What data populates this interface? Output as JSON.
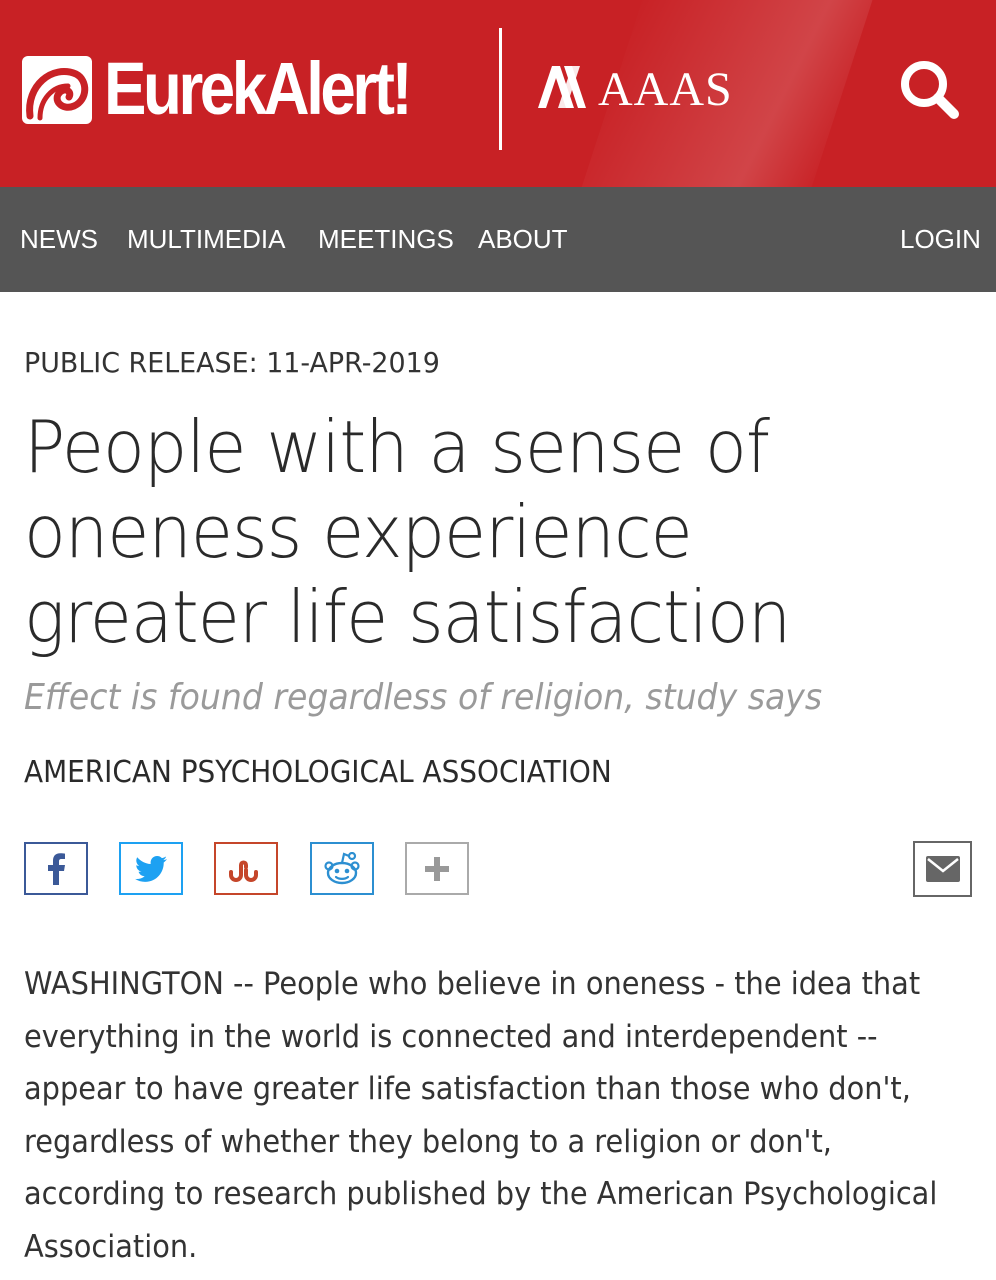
{
  "header": {
    "logo_text": "EurekAlert!",
    "partner_text": "AAAS",
    "background_color": "#c82125",
    "search_icon": "search-icon"
  },
  "nav": {
    "items": [
      {
        "label": "NEWS"
      },
      {
        "label": "MULTIMEDIA"
      },
      {
        "label": "MEETINGS"
      },
      {
        "label": "ABOUT"
      }
    ],
    "login_label": "LOGIN",
    "background_color": "#555555"
  },
  "article": {
    "release_label": "PUBLIC RELEASE: 11-APR-2019",
    "headline_lines": [
      "People with a sense of",
      "oneness experience",
      "greater life satisfaction"
    ],
    "subhead": "Effect is found regardless of religion, study says",
    "organization": "AMERICAN PSYCHOLOGICAL ASSOCIATION",
    "body_lines": [
      "WASHINGTON -- People who believe in oneness - the idea that",
      "everything in the world is connected and interdependent --",
      "appear to have greater life satisfaction than those who don't,",
      "regardless of whether they belong to a religion or don't,",
      "according to research published by the American Psychological",
      "Association."
    ]
  },
  "share": {
    "buttons": [
      {
        "icon": "facebook-icon",
        "color": "#3b5998"
      },
      {
        "icon": "twitter-icon",
        "color": "#1da1f2"
      },
      {
        "icon": "stumbleupon-icon",
        "color": "#c5462a"
      },
      {
        "icon": "reddit-icon",
        "color": "#2c8fd1"
      },
      {
        "icon": "plus-icon",
        "color": "#999999"
      }
    ],
    "email": {
      "icon": "email-icon",
      "color": "#666666"
    }
  }
}
